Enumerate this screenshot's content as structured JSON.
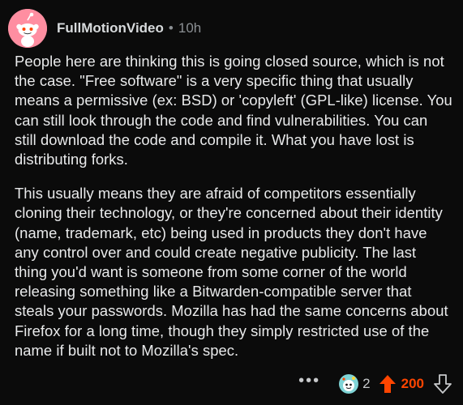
{
  "comment": {
    "username": "FullMotionVideo",
    "separator": "•",
    "time_ago": "10h",
    "paragraphs": [
      "People here are thinking this is going closed source, which is not the case. \"Free software\" is a very specific thing that usually means a permissive (ex: BSD) or 'copyleft' (GPL-like) license. You can still look through the code and find vulnerabilities. You can still download the code and compile it. What you have lost is distributing forks.",
      "This usually means they are afraid of competitors essentially cloning their technology, or they're concerned about their identity (name, trademark, etc) being used in products they don't have any control over and could create negative publicity. The last thing you'd want is someone from some corner of the world releasing something like a Bitwarden-compatible server that steals your passwords. Mozilla has had the same concerns about Firefox for a long time, though they simply restricted use of the name if built not to Mozilla's spec."
    ]
  },
  "actions": {
    "more_label": "•••",
    "award_icon": "award-snoo-icon",
    "award_count": "2",
    "upvote_icon": "upvote-arrow-icon",
    "score": "200",
    "downvote_icon": "downvote-arrow-icon"
  },
  "colors": {
    "background": "#0b0b0b",
    "avatar_bg": "#ff8ea1",
    "upvote_active": "#ff4500",
    "text_primary": "#e9eaeb",
    "text_muted": "#8b8f93"
  }
}
